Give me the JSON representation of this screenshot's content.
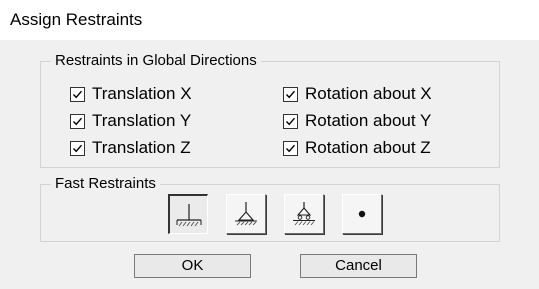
{
  "dialog": {
    "title": "Assign Restraints"
  },
  "global_group": {
    "title": "Restraints in Global Directions",
    "items": [
      {
        "label": "Translation X",
        "checked": true
      },
      {
        "label": "Translation Y",
        "checked": true
      },
      {
        "label": "Translation Z",
        "checked": true
      },
      {
        "label": "Rotation about X",
        "checked": true
      },
      {
        "label": "Rotation about Y",
        "checked": true
      },
      {
        "label": "Rotation about Z",
        "checked": true
      }
    ]
  },
  "fast_group": {
    "title": "Fast Restraints",
    "buttons": [
      {
        "icon": "fixed-support-icon",
        "pressed": true
      },
      {
        "icon": "pinned-support-icon",
        "pressed": false
      },
      {
        "icon": "roller-support-icon",
        "pressed": false
      },
      {
        "icon": "free-node-icon",
        "pressed": false
      }
    ]
  },
  "footer": {
    "ok_label": "OK",
    "cancel_label": "Cancel"
  }
}
